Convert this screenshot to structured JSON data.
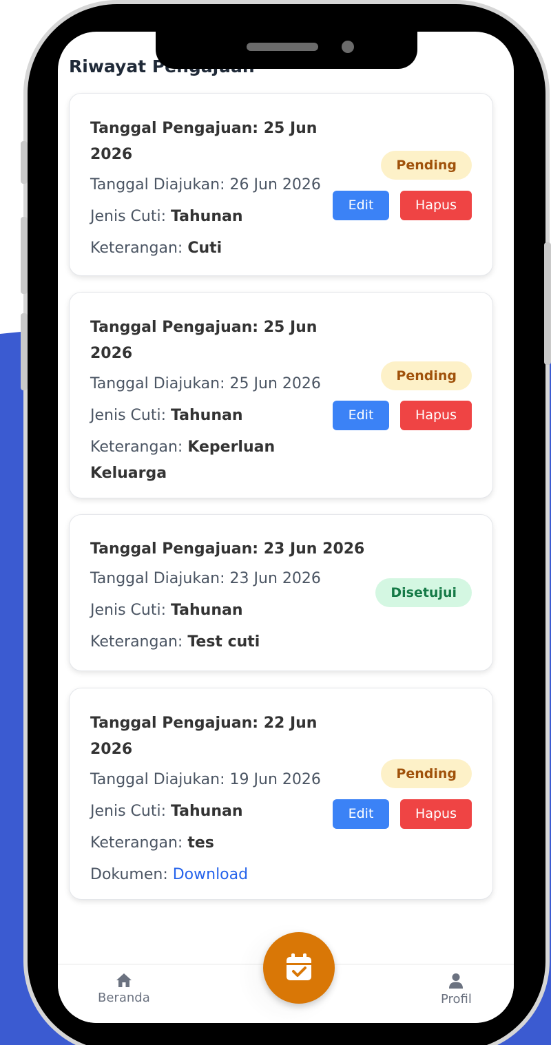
{
  "page": {
    "title": "Riwayat Pengajuan"
  },
  "labels": {
    "submitted_date": "Tanggal Diajukan:",
    "leave_type": "Jenis Cuti:",
    "note": "Keterangan:",
    "document": "Dokumen:"
  },
  "submissions": [
    {
      "heading": "Tanggal Pengajuan: 25 Jun 2026",
      "submitted_date": "26 Jun 2026",
      "leave_type": "Tahunan",
      "note": "Cuti",
      "status": "Pending",
      "edit_label": "Edit",
      "delete_label": "Hapus"
    },
    {
      "heading": "Tanggal Pengajuan: 25 Jun 2026",
      "submitted_date": "25 Jun 2026",
      "leave_type": "Tahunan",
      "note": "Keperluan Keluarga",
      "status": "Pending",
      "edit_label": "Edit",
      "delete_label": "Hapus"
    },
    {
      "heading": "Tanggal Pengajuan: 23 Jun 2026",
      "submitted_date": "23 Jun 2026",
      "leave_type": "Tahunan",
      "note": "Test cuti",
      "status": "Disetujui"
    },
    {
      "heading": "Tanggal Pengajuan: 22 Jun 2026",
      "submitted_date": "19 Jun 2026",
      "leave_type": "Tahunan",
      "note": "tes",
      "document_link": "Download",
      "status": "Pending",
      "edit_label": "Edit",
      "delete_label": "Hapus"
    }
  ],
  "nav": {
    "home_label": "Beranda",
    "profile_label": "Profil",
    "fab_icon": "calendar-check-icon"
  },
  "colors": {
    "accent_blue": "#3b82f6",
    "danger_red": "#ef4444",
    "fab_orange": "#d97706",
    "pending_bg": "#fdf1c8",
    "approved_bg": "#d4f7e2",
    "background_blue": "#3b5bd1"
  }
}
